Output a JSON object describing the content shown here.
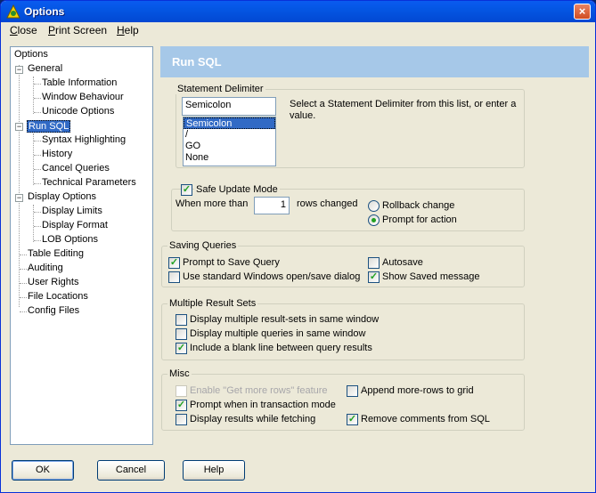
{
  "window": {
    "title": "Options",
    "close_glyph": "×"
  },
  "menu": {
    "items": [
      {
        "label": "Close",
        "underline": "C",
        "rest": "lose"
      },
      {
        "label": "Print Screen",
        "underline": "P",
        "rest": "rint Screen"
      },
      {
        "label": "Help",
        "underline": "H",
        "rest": "elp"
      }
    ]
  },
  "tree": {
    "root": "Options",
    "general": "General",
    "table_information": "Table Information",
    "window_behaviour": "Window Behaviour",
    "unicode_options": "Unicode Options",
    "run_sql": "Run SQL",
    "syntax_highlighting": "Syntax Highlighting",
    "history": "History",
    "cancel_queries": "Cancel Queries",
    "technical_parameters": "Technical Parameters",
    "display_options": "Display Options",
    "display_limits": "Display Limits",
    "display_format": "Display Format",
    "lob_options": "LOB Options",
    "table_editing": "Table Editing",
    "auditing": "Auditing",
    "user_rights": "User Rights",
    "file_locations": "File Locations",
    "config_files": "Config Files",
    "expand_glyph": "−"
  },
  "header": {
    "title": "Run SQL"
  },
  "delimiter": {
    "group_title": "Statement Delimiter",
    "input_value": "Semicolon",
    "options": [
      "Semicolon",
      "/",
      "GO",
      "None"
    ],
    "help_line1": "Select a Statement Delimiter from this list, or enter a",
    "help_line2": "value."
  },
  "safe_update": {
    "title": "Safe Update Mode",
    "checked": true,
    "when_more_than": "When more than",
    "rows_value": "1",
    "rows_changed": "rows changed",
    "rollback": "Rollback change",
    "prompt": "Prompt for action",
    "selected": "prompt"
  },
  "saving": {
    "group_title": "Saving Queries",
    "prompt_to_save": "Prompt to Save Query",
    "use_standard": "Use standard Windows open/save dialog",
    "autosave": "Autosave",
    "show_saved": "Show Saved message"
  },
  "multiple": {
    "group_title": "Multiple Result Sets",
    "same_window": "Display multiple result-sets in same window",
    "queries_same_window": "Display multiple queries in same window",
    "blank_line": "Include a blank line between query results"
  },
  "misc": {
    "group_title": "Misc",
    "enable_get_more": "Enable \"Get more rows\" feature",
    "prompt_transaction": "Prompt when in transaction mode",
    "display_while_fetching": "Display results while fetching",
    "append_more_rows": "Append more-rows to grid",
    "remove_comments": "Remove comments from SQL"
  },
  "check_glyph": "✓",
  "buttons": {
    "ok": "OK",
    "cancel": "Cancel",
    "help": "Help"
  },
  "colors": {
    "titlebar": "#0456e3",
    "header": "#a6c8e8",
    "selection": "#316ac5",
    "check": "#21a121"
  }
}
